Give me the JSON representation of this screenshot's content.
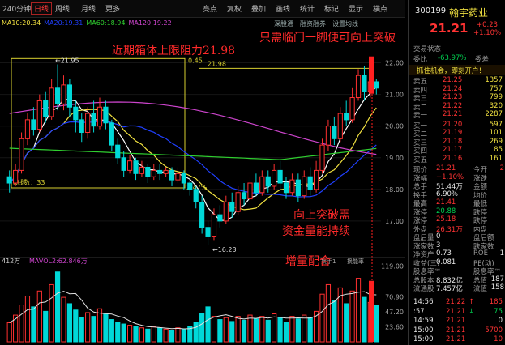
{
  "toolbar": {
    "items": [
      "240分钟",
      "日线",
      "周线",
      "月线",
      "更多",
      "亮点",
      "复权",
      "叠加",
      "画线",
      "统计",
      "标记",
      "显示",
      "横点"
    ],
    "active": "日线"
  },
  "top_links": [
    "深股通",
    "融资融券",
    "设置均线"
  ],
  "ma_legend": [
    {
      "label": "MA10:20.34",
      "color": "#f0e040"
    },
    {
      "label": "MA20:19.31",
      "color": "#2040ff"
    },
    {
      "label": "MA60:18.94",
      "color": "#30d030"
    },
    {
      "label": "MA120:19.22",
      "color": "#cc44cc"
    }
  ],
  "price_axis": {
    "ticks": [
      "22.00",
      "21.00",
      "20.00",
      "19.00",
      "18.00",
      "17.00"
    ],
    "ylim": [
      16.0,
      22.5
    ]
  },
  "volume_axis": {
    "ticks": [
      "119.00",
      "70.90",
      "47.20",
      "23.60"
    ],
    "unit": "万"
  },
  "annotations": {
    "box_label": "近期箱体上限阻力21.98",
    "breakout_label": "只需临门一脚便可向上突破",
    "volume_label_1": "向上突破需",
    "volume_label_2": "资金量能持续",
    "volume_label_3": "增量配合",
    "high_marker": "21.95",
    "low_marker": "16.23",
    "level_marker": "21.98",
    "box_ratio_top": "0.45",
    "kline_count": "K线数：33",
    "box_pct": "2.47%"
  },
  "vol_legend": {
    "vol": "412万",
    "volma": "MAVOL2:62.846万",
    "extra": "换手1",
    "extra2": "换能率"
  },
  "stock": {
    "code": "300199",
    "name": "翰宇药业",
    "price": "21.21",
    "change": "+0.23",
    "change_pct": "+1.10%",
    "status": "交易状态",
    "weibi_label": "委比",
    "weibi": "-63.97%",
    "weicha_label": "委差",
    "weicha": "-",
    "promo": "抓住机会，即刻开户！"
  },
  "order_book": {
    "asks": [
      {
        "label": "卖五",
        "price": "21.25",
        "vol": "1357"
      },
      {
        "label": "卖四",
        "price": "21.24",
        "vol": "757"
      },
      {
        "label": "卖三",
        "price": "21.23",
        "vol": "799"
      },
      {
        "label": "卖二",
        "price": "21.22",
        "vol": "320"
      },
      {
        "label": "卖一",
        "price": "21.21",
        "vol": "2287"
      }
    ],
    "bids": [
      {
        "label": "买一",
        "price": "21.20",
        "vol": "597"
      },
      {
        "label": "买二",
        "price": "21.19",
        "vol": "101"
      },
      {
        "label": "买三",
        "price": "21.18",
        "vol": "269"
      },
      {
        "label": "买四",
        "price": "21.17",
        "vol": "85"
      },
      {
        "label": "买五",
        "price": "21.16",
        "vol": "161"
      }
    ]
  },
  "quote_stats": [
    {
      "l1": "现价",
      "v1": "21.21",
      "c1": "red",
      "l2": "今开",
      "v2": "2",
      "c2": "red"
    },
    {
      "l1": "涨幅",
      "v1": "+1.10%",
      "c1": "red",
      "l2": "涨跌",
      "v2": "",
      "c2": "red"
    },
    {
      "l1": "总手",
      "v1": "51.44万",
      "c1": "white",
      "l2": "金额",
      "v2": "",
      "c2": "white"
    },
    {
      "l1": "换手",
      "v1": "6.90%",
      "c1": "white",
      "l2": "均价",
      "v2": "",
      "c2": "white"
    },
    {
      "l1": "最高",
      "v1": "21.41",
      "c1": "red",
      "l2": "最低",
      "v2": "",
      "c2": "green"
    },
    {
      "l1": "涨停",
      "v1": "20.88",
      "c1": "green",
      "l2": "跌停",
      "v2": "",
      "c2": "green"
    },
    {
      "l1": "涨停",
      "v1": "25.18",
      "c1": "red",
      "l2": "跌停",
      "v2": "",
      "c2": "green"
    },
    {
      "l1": "外盘",
      "v1": "26.31万",
      "c1": "red",
      "l2": "内盘",
      "v2": "",
      "c2": "green"
    },
    {
      "l1": "盘后量",
      "v1": "0",
      "c1": "white",
      "l2": "盘后额",
      "v2": "",
      "c2": "white"
    },
    {
      "l1": "涨家数",
      "v1": "3",
      "c1": "white",
      "l2": "跌家数",
      "v2": "",
      "c2": "white"
    },
    {
      "l1": "净资产",
      "v1": "0.73",
      "c1": "white",
      "l2": "ROE",
      "v2": "1",
      "c2": "white"
    },
    {
      "l1": "收益(三)",
      "v1": "0.081",
      "c1": "white",
      "l2": "PE(动)",
      "v2": "",
      "c2": "white"
    },
    {
      "l1": "股息率™",
      "v1": "-",
      "c1": "white",
      "l2": "股息率™",
      "v2": "",
      "c2": "white"
    },
    {
      "l1": "总股本",
      "v1": "8.832亿",
      "c1": "white",
      "l2": "总值",
      "v2": "187",
      "c2": "white"
    },
    {
      "l1": "流通股",
      "v1": "7.457亿",
      "c1": "white",
      "l2": "流值",
      "v2": "158",
      "c2": "white"
    }
  ],
  "ticks_list": [
    {
      "time": "14:56",
      "price": "21.22",
      "arrow": "↑",
      "vol": "185",
      "pc": "red",
      "vc": "red"
    },
    {
      "time": ":57",
      "price": "21.21",
      "arrow": "↓",
      "vol": "75",
      "pc": "red",
      "vc": "green"
    },
    {
      "time": "14:59",
      "price": "21.21",
      "arrow": "",
      "vol": "0",
      "pc": "red",
      "vc": "white"
    },
    {
      "time": "15:00",
      "price": "21.21",
      "arrow": "",
      "vol": "5700",
      "pc": "red",
      "vc": "red"
    },
    {
      "time": "15:00",
      "price": "21.21",
      "arrow": "",
      "vol": "10",
      "pc": "red",
      "vc": "red"
    }
  ],
  "chart_data": {
    "type": "candlestick",
    "ylim": [
      16.0,
      22.5
    ],
    "candles": [
      [
        18.4,
        18.2,
        18.6,
        17.9
      ],
      [
        18.2,
        18.6,
        18.8,
        18.1
      ],
      [
        18.6,
        19.6,
        19.8,
        18.5
      ],
      [
        19.6,
        20.2,
        20.4,
        19.4
      ],
      [
        20.2,
        19.9,
        20.6,
        19.7
      ],
      [
        19.9,
        20.8,
        21.0,
        19.8
      ],
      [
        20.8,
        20.3,
        21.1,
        20.1
      ],
      [
        20.3,
        21.2,
        21.5,
        20.2
      ],
      [
        21.2,
        20.7,
        21.95,
        20.5
      ],
      [
        20.7,
        21.3,
        21.6,
        20.5
      ],
      [
        21.3,
        20.6,
        21.5,
        20.3
      ],
      [
        20.6,
        20.2,
        20.8,
        19.8
      ],
      [
        20.2,
        19.8,
        20.4,
        19.5
      ],
      [
        19.8,
        20.4,
        20.6,
        19.6
      ],
      [
        20.4,
        20.0,
        20.8,
        19.8
      ],
      [
        20.0,
        20.6,
        20.9,
        19.9
      ],
      [
        20.6,
        20.1,
        20.8,
        19.9
      ],
      [
        20.1,
        19.4,
        20.2,
        19.2
      ],
      [
        19.4,
        19.0,
        19.6,
        18.8
      ],
      [
        19.0,
        18.6,
        19.2,
        18.4
      ],
      [
        18.6,
        18.9,
        19.1,
        18.5
      ],
      [
        18.9,
        18.5,
        19.0,
        18.3
      ],
      [
        18.5,
        18.7,
        18.9,
        18.4
      ],
      [
        18.7,
        18.4,
        18.8,
        18.2
      ],
      [
        18.4,
        18.6,
        18.8,
        18.3
      ],
      [
        18.6,
        18.5,
        18.8,
        18.3
      ],
      [
        18.5,
        18.6,
        18.7,
        18.4
      ],
      [
        18.6,
        18.3,
        18.7,
        18.1
      ],
      [
        18.3,
        18.5,
        18.7,
        18.2
      ],
      [
        18.5,
        18.2,
        18.6,
        18.0
      ],
      [
        18.2,
        18.0,
        18.3,
        17.8
      ],
      [
        18.0,
        17.6,
        18.1,
        17.4
      ],
      [
        17.6,
        16.8,
        17.8,
        16.6
      ],
      [
        16.8,
        16.5,
        17.0,
        16.23
      ],
      [
        16.5,
        17.2,
        17.4,
        16.4
      ],
      [
        17.2,
        17.0,
        17.5,
        16.8
      ],
      [
        17.0,
        17.6,
        17.8,
        16.9
      ],
      [
        17.6,
        17.3,
        17.9,
        17.1
      ],
      [
        17.3,
        17.9,
        18.1,
        17.2
      ],
      [
        17.9,
        17.7,
        18.2,
        17.5
      ],
      [
        17.7,
        18.2,
        18.4,
        17.6
      ],
      [
        18.2,
        17.9,
        18.5,
        17.8
      ],
      [
        17.9,
        18.4,
        18.6,
        17.8
      ],
      [
        18.4,
        18.1,
        18.6,
        17.9
      ],
      [
        18.1,
        18.6,
        18.8,
        18.0
      ],
      [
        18.6,
        18.2,
        18.9,
        18.0
      ],
      [
        18.2,
        17.9,
        18.4,
        17.7
      ],
      [
        17.9,
        18.3,
        18.5,
        17.8
      ],
      [
        18.3,
        17.8,
        18.5,
        17.6
      ],
      [
        17.8,
        18.4,
        18.6,
        17.7
      ],
      [
        18.4,
        18.0,
        18.7,
        17.8
      ],
      [
        18.0,
        18.6,
        18.9,
        17.9
      ],
      [
        18.6,
        19.4,
        19.6,
        18.5
      ],
      [
        19.4,
        20.0,
        20.2,
        19.2
      ],
      [
        20.0,
        19.6,
        20.3,
        19.4
      ],
      [
        19.6,
        20.4,
        20.6,
        19.5
      ],
      [
        20.4,
        20.2,
        20.8,
        20.0
      ],
      [
        20.2,
        20.9,
        21.2,
        20.1
      ],
      [
        20.9,
        21.6,
        21.8,
        20.8
      ],
      [
        21.6,
        21.1,
        21.9,
        20.8
      ],
      [
        21.1,
        21.4,
        21.6,
        20.9
      ],
      [
        21.4,
        21.2,
        21.5,
        21.0
      ]
    ],
    "volumes": [
      30,
      42,
      58,
      72,
      55,
      80,
      48,
      90,
      110,
      70,
      60,
      50,
      38,
      46,
      40,
      52,
      45,
      35,
      30,
      28,
      26,
      24,
      22,
      20,
      24,
      22,
      20,
      18,
      22,
      20,
      24,
      30,
      45,
      55,
      40,
      35,
      38,
      32,
      40,
      34,
      42,
      36,
      40,
      34,
      44,
      38,
      30,
      40,
      36,
      42,
      38,
      48,
      75,
      90,
      65,
      85,
      60,
      80,
      100,
      70,
      62,
      58
    ],
    "vol_up": [
      true,
      true,
      true,
      true,
      false,
      true,
      false,
      true,
      false,
      true,
      false,
      false,
      false,
      true,
      false,
      true,
      false,
      false,
      false,
      false,
      true,
      false,
      true,
      false,
      true,
      false,
      true,
      false,
      true,
      false,
      false,
      false,
      false,
      false,
      true,
      false,
      true,
      false,
      true,
      false,
      true,
      false,
      true,
      false,
      true,
      false,
      false,
      true,
      false,
      true,
      false,
      true,
      true,
      true,
      false,
      true,
      false,
      true,
      true,
      false,
      true,
      false
    ]
  }
}
